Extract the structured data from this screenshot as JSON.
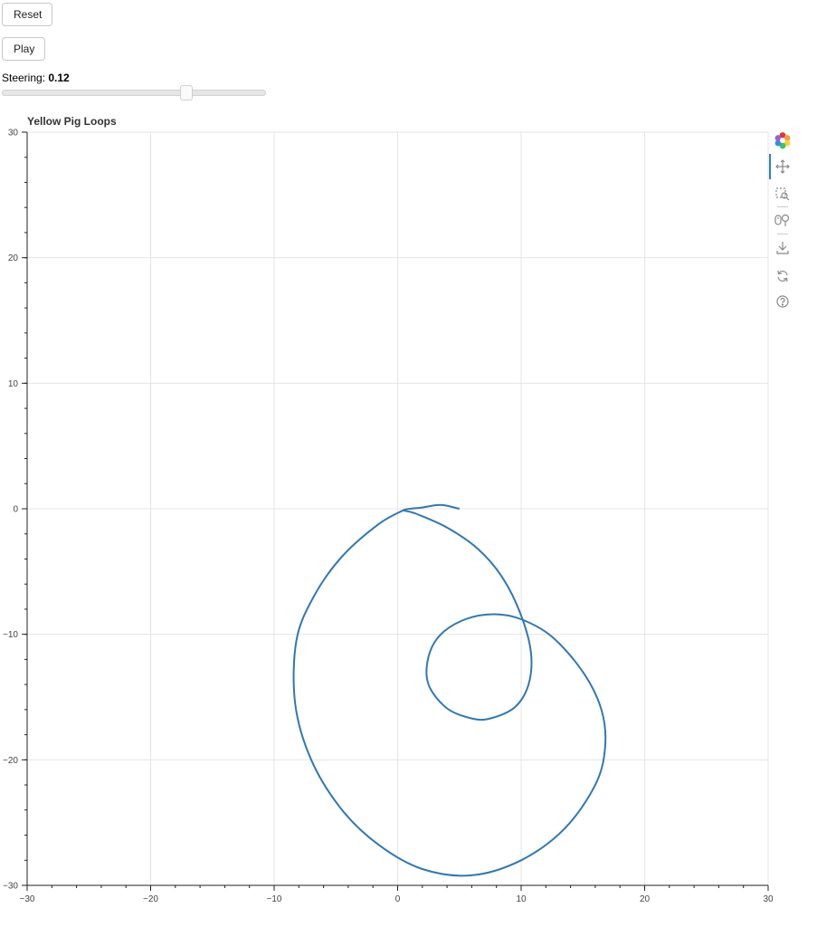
{
  "controls": {
    "reset_label": "Reset",
    "play_label": "Play",
    "slider_label": "Steering: ",
    "slider_value": "0.12",
    "slider_min": -0.3,
    "slider_max": 0.3,
    "slider_current": 0.12
  },
  "toolbar": {
    "items": [
      "bokeh-logo-icon",
      "pan-icon",
      "box-zoom-icon",
      "wheel-zoom-icon",
      "save-icon",
      "reset-icon",
      "help-icon"
    ],
    "active": "pan-icon"
  },
  "colors": {
    "line": "#2f78b4",
    "grid": "#e5e5e5",
    "axis": "#222222"
  },
  "chart_data": {
    "type": "line",
    "title": "Yellow Pig Loops",
    "xlim": [
      -30,
      30
    ],
    "ylim": [
      -30,
      30
    ],
    "xticks": [
      -30,
      -20,
      -10,
      0,
      10,
      20,
      30
    ],
    "yticks": [
      -30,
      -20,
      -10,
      0,
      10,
      20,
      30
    ],
    "xtick_labels": [
      "−30",
      "−20",
      "−10",
      "0",
      "10",
      "20",
      "30"
    ],
    "ytick_labels": [
      "−30",
      "−20",
      "−10",
      "0",
      "10",
      "20",
      "30"
    ],
    "grid": true,
    "series": [
      {
        "x": [
          5.0,
          3.5,
          2.0,
          0.5,
          1.5,
          4.0,
          6.5,
          8.5,
          10.0,
          10.8,
          10.6,
          9.5,
          7.5,
          6.0,
          4.0,
          2.5,
          2.5,
          3.5,
          5.5,
          7.8,
          10.0,
          12.5,
          15.0,
          16.5,
          16.8,
          16.0,
          13.5,
          10.0,
          6.0,
          2.0,
          -1.5,
          -4.5,
          -7.0,
          -8.3,
          -8.2,
          -6.8,
          -4.5,
          -1.5,
          0.5
        ],
        "y": [
          0.0,
          0.3,
          0.1,
          -0.1,
          -0.4,
          -1.5,
          -3.2,
          -5.5,
          -8.5,
          -11.5,
          -14.0,
          -15.8,
          -16.7,
          -16.7,
          -15.9,
          -14.0,
          -11.8,
          -10.0,
          -8.8,
          -8.4,
          -8.8,
          -10.2,
          -13.0,
          -16.0,
          -19.0,
          -22.0,
          -25.5,
          -28.0,
          -29.2,
          -28.7,
          -26.8,
          -24.0,
          -20.0,
          -15.5,
          -10.5,
          -7.0,
          -3.8,
          -1.2,
          -0.1
        ]
      }
    ]
  }
}
